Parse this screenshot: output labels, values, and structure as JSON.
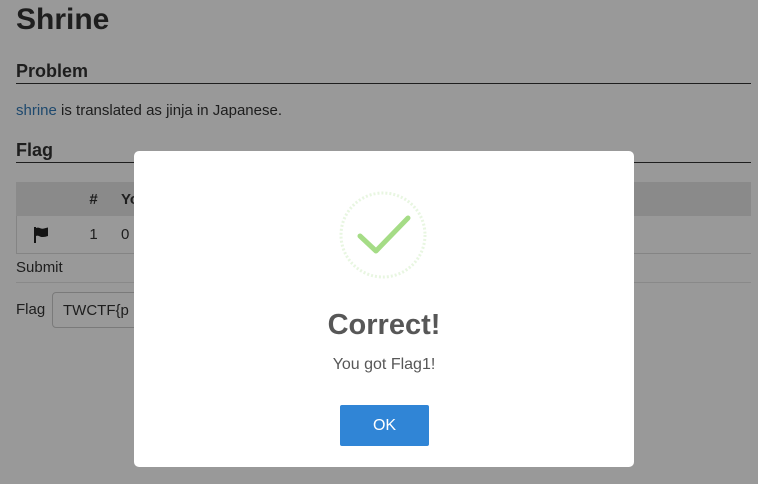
{
  "page": {
    "title": "Shrine",
    "problem": {
      "heading": "Problem",
      "link_text": "shrine",
      "rest_text": " is translated as jinja in Japanese."
    },
    "flag": {
      "heading": "Flag",
      "table": {
        "headers": [
          "",
          "#",
          "Yo"
        ],
        "rows": [
          {
            "icon": "flag-icon",
            "number": "1",
            "value": "0"
          }
        ]
      },
      "submit_label": "Submit",
      "flag_label": "Flag",
      "flag_value": "TWCTF{p"
    }
  },
  "modal": {
    "icon": "check-icon",
    "title": "Correct!",
    "message": "You got Flag1!",
    "ok_label": "OK"
  },
  "colors": {
    "link": "#337ab7",
    "ok_button": "#3085d6",
    "check": "#a5dc86",
    "overlay": "rgba(0,0,0,0.4)"
  }
}
